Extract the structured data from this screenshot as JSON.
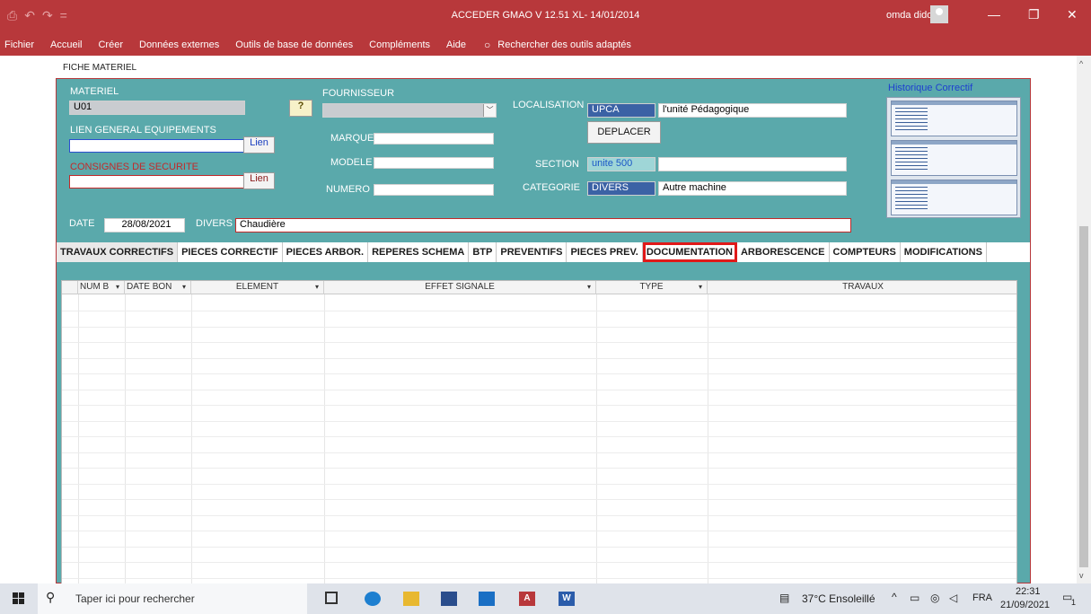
{
  "titlebar": {
    "qat": [
      "⎙",
      "↶",
      "↷",
      "="
    ],
    "title": "ACCEDER GMAO V 12.51  XL- 14/01/2014",
    "user": "omda dido",
    "minimize": "—",
    "restore": "❐",
    "close": "✕"
  },
  "ribbon": {
    "tabs": [
      "Fichier",
      "Accueil",
      "Créer",
      "Données externes",
      "Outils de base de données",
      "Compléments",
      "Aide",
      "Rechercher des outils adaptés"
    ]
  },
  "form": {
    "title": "FICHE MATERIEL",
    "materiel_label": "MATERIEL",
    "materiel_value": "U01",
    "fournisseur_label": "FOURNISSEUR",
    "fournisseur_value": "",
    "lien_general_label": "LIEN GENERAL EQUIPEMENTS",
    "lien_general_value": "",
    "lien_button": "Lien",
    "consignes_label": "CONSIGNES DE SECURITE",
    "consignes_value": "",
    "lien_button_2": "Lien",
    "marque_label": "MARQUE",
    "modele_label": "MODELE",
    "numero_label": "NUMERO",
    "localisation_label": "LOCALISATION",
    "localisation_code": "UPCA",
    "localisation_name": "l'unité Pédagogique",
    "deplacer_button": "DEPLACER",
    "section_label": "SECTION",
    "section_code": "unite 500",
    "section_name": "",
    "categorie_label": "CATEGORIE",
    "categorie_code": "DIVERS",
    "categorie_name": "Autre machine",
    "date_label": "DATE",
    "date_value": "28/08/2021",
    "divers_label": "DIVERS",
    "divers_value": "Chaudière",
    "historique_label": "Historique  Correctif",
    "help_button": "?"
  },
  "tabs": [
    "TRAVAUX CORRECTIFS",
    "PIECES CORRECTIF",
    "PIECES ARBOR.",
    "REPERES SCHEMA",
    "BTP",
    "PREVENTIFS",
    "PIECES PREV.",
    "DOCUMENTATION",
    "ARBORESCENCE",
    "COMPTEURS",
    "MODIFICATIONS"
  ],
  "grid": {
    "columns": [
      "NUM B",
      "DATE BON",
      "ELEMENT",
      "EFFET SIGNALE",
      "TYPE",
      "TRAVAUX"
    ]
  },
  "taskbar": {
    "search_placeholder": "Taper ici pour rechercher",
    "weather": "37°C  Ensoleillé",
    "lang": "FRA",
    "time": "22:31",
    "date": "21/09/2021",
    "notif": "1"
  },
  "colors": {
    "accent": "#b8383b",
    "form_bg": "#5aa9ab",
    "highlight": "#e01919"
  }
}
